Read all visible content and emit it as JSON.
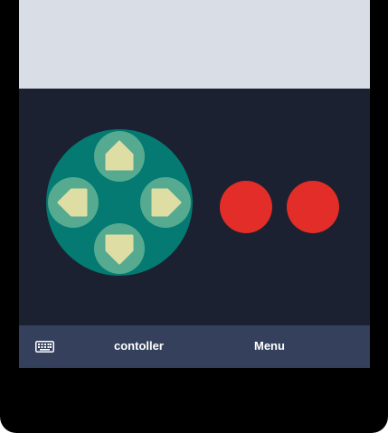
{
  "colors": {
    "top_panel": "#d9dee6",
    "controller_bg": "#1b2130",
    "dpad_base": "#047a72",
    "dpad_button": "#55aa90",
    "dpad_arrow": "#dedea4",
    "action_button": "#e22d28",
    "bottom_bar": "#35415c",
    "frame": "#000000"
  },
  "controller": {
    "dpad": {
      "up": "arrow-up-icon",
      "down": "arrow-down-icon",
      "left": "arrow-left-icon",
      "right": "arrow-right-icon"
    },
    "action_buttons": [
      "action-button-1",
      "action-button-2"
    ]
  },
  "bottom_bar": {
    "keyboard_icon": "keyboard-icon",
    "tabs": [
      {
        "label": "contoller"
      },
      {
        "label": "Menu"
      }
    ]
  }
}
